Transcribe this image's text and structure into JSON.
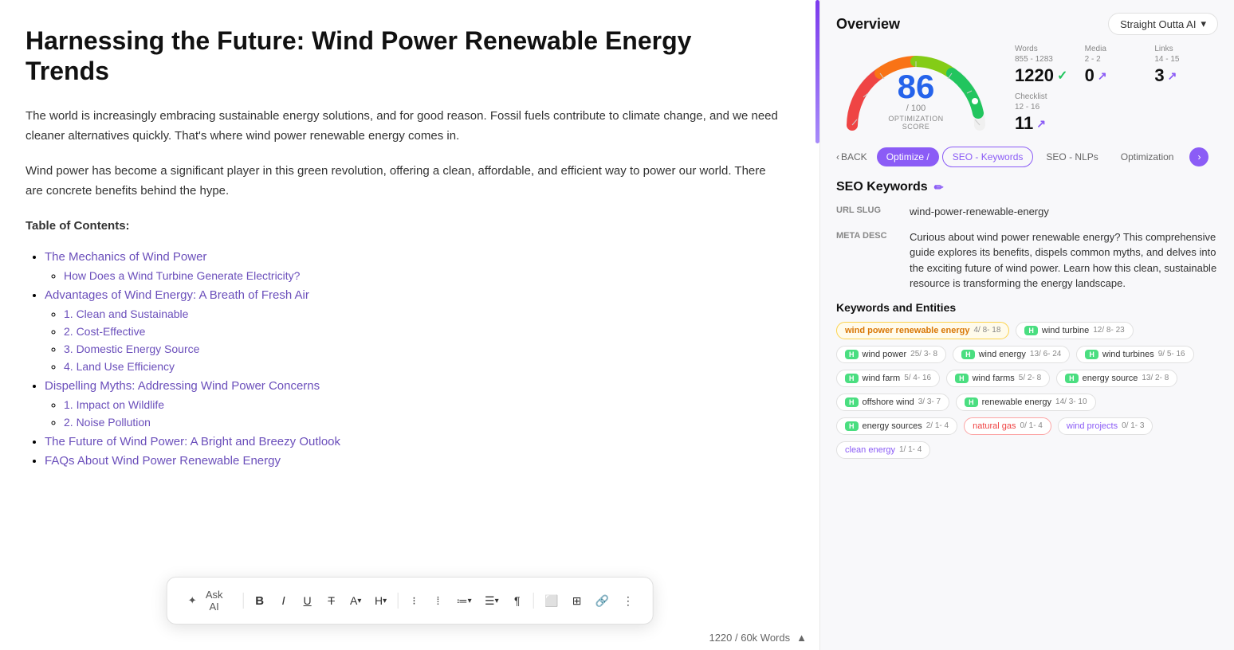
{
  "editor": {
    "title": "Harnessing the Future: Wind Power Renewable Energy Trends",
    "paragraphs": [
      "The world is increasingly embracing sustainable energy solutions, and for good reason. Fossil fuels contribute to climate change, and we need cleaner alternatives quickly. That's where wind power renewable energy comes in.",
      "Wind power has become a significant player in this green revolution, offering a clean, affordable, and efficient way to power our world. There are concrete benefits behind the hype."
    ],
    "toc_heading": "Table of Contents:",
    "toc_items": [
      {
        "label": "The Mechanics of Wind Power",
        "subitems": [
          "How Does a Wind Turbine Generate Electricity?"
        ]
      },
      {
        "label": "Advantages of Wind Energy: A Breath of Fresh Air",
        "subitems": [
          "1. Clean and Sustainable",
          "2. Cost-Effective",
          "3. Domestic Energy Source",
          "4. Land Use Efficiency"
        ]
      },
      {
        "label": "Dispelling Myths: Addressing Wind Power Concerns",
        "subitems": [
          "1. Impact on Wildlife",
          "2. Noise Pollution"
        ]
      },
      {
        "label": "The Future of Wind Power: A Bright and Breezy Outlook",
        "subitems": []
      },
      {
        "label": "FAQs About Wind Power Renewable Energy",
        "subitems": []
      }
    ],
    "word_count": "1220 / 60k Words"
  },
  "toolbar": {
    "ask_ai_label": "Ask AI",
    "bold_label": "B",
    "italic_label": "I",
    "underline_label": "U",
    "strikethrough_label": "T",
    "font_label": "A",
    "heading_label": "H",
    "align_left_label": "≡",
    "align_center_label": "≡",
    "list_ol_label": "OL",
    "list_ul_label": "UL",
    "paragraph_label": "¶",
    "image_label": "IMG",
    "table_label": "TBL",
    "link_label": "🔗",
    "more_label": "⋮"
  },
  "panel": {
    "title": "Overview",
    "straight_outta_label": "Straight Outta AI",
    "gauge": {
      "score": "86",
      "max": "100",
      "label": "OPTIMIZATION SCORE"
    },
    "stats": {
      "words_label": "Words",
      "words_range": "855 - 1283",
      "words_value": "1220",
      "words_status": "check",
      "media_label": "Media",
      "media_range": "2 - 2",
      "media_value": "0",
      "media_status": "arrow",
      "links_label": "Links",
      "links_range": "14 - 15",
      "links_value": "3",
      "links_status": "arrow",
      "checklist_label": "Checklist",
      "checklist_range": "12 - 16",
      "checklist_value": "11",
      "checklist_status": "arrow"
    },
    "nav_tabs": [
      {
        "label": "< BACK",
        "type": "back"
      },
      {
        "label": "Optimize /",
        "type": "active"
      },
      {
        "label": "SEO - Keywords",
        "type": "outlined"
      },
      {
        "label": "SEO - NLPs",
        "type": "normal"
      },
      {
        "label": "Optimization",
        "type": "normal"
      }
    ],
    "seo_keywords_heading": "SEO Keywords",
    "url_slug_label": "URL SLUG",
    "url_slug_value": "wind-power-renewable-energy",
    "meta_desc_label": "META DESC",
    "meta_desc_value": "Curious about wind power renewable energy? This comprehensive guide explores its benefits, dispels common myths, and delves into the exciting future of wind power. Learn how this clean, sustainable resource is transforming the energy landscape.",
    "keywords_heading": "Keywords and Entities",
    "keywords": [
      {
        "text": "wind power renewable energy",
        "stats": "4/ 8- 18",
        "type": "highlighted"
      },
      {
        "text": "wind turbine",
        "stats": "12/ 8- 23",
        "type": "h-badge"
      },
      {
        "text": "wind power",
        "stats": "25/ 3- 8",
        "type": "h-badge"
      },
      {
        "text": "wind energy",
        "stats": "13/ 6- 24",
        "type": "h-badge"
      },
      {
        "text": "wind turbines",
        "stats": "9/ 5- 16",
        "type": "h-badge"
      },
      {
        "text": "wind farm",
        "stats": "5/ 4- 16",
        "type": "h-badge"
      },
      {
        "text": "wind farms",
        "stats": "5/ 2- 8",
        "type": "h-badge"
      },
      {
        "text": "energy source",
        "stats": "13/ 2- 8",
        "type": "h-badge"
      },
      {
        "text": "offshore wind",
        "stats": "3/ 3- 7",
        "type": "h-badge"
      },
      {
        "text": "renewable energy",
        "stats": "14/ 3- 10",
        "type": "h-badge"
      },
      {
        "text": "energy sources",
        "stats": "2/ 1- 4",
        "type": "h-badge"
      },
      {
        "text": "natural gas",
        "stats": "0/ 1- 4",
        "type": "natural-gas"
      },
      {
        "text": "wind projects",
        "stats": "0/ 1- 3",
        "type": "wind-projects"
      },
      {
        "text": "clean energy",
        "stats": "1/ 1- 4",
        "type": "clean-energy"
      }
    ]
  }
}
